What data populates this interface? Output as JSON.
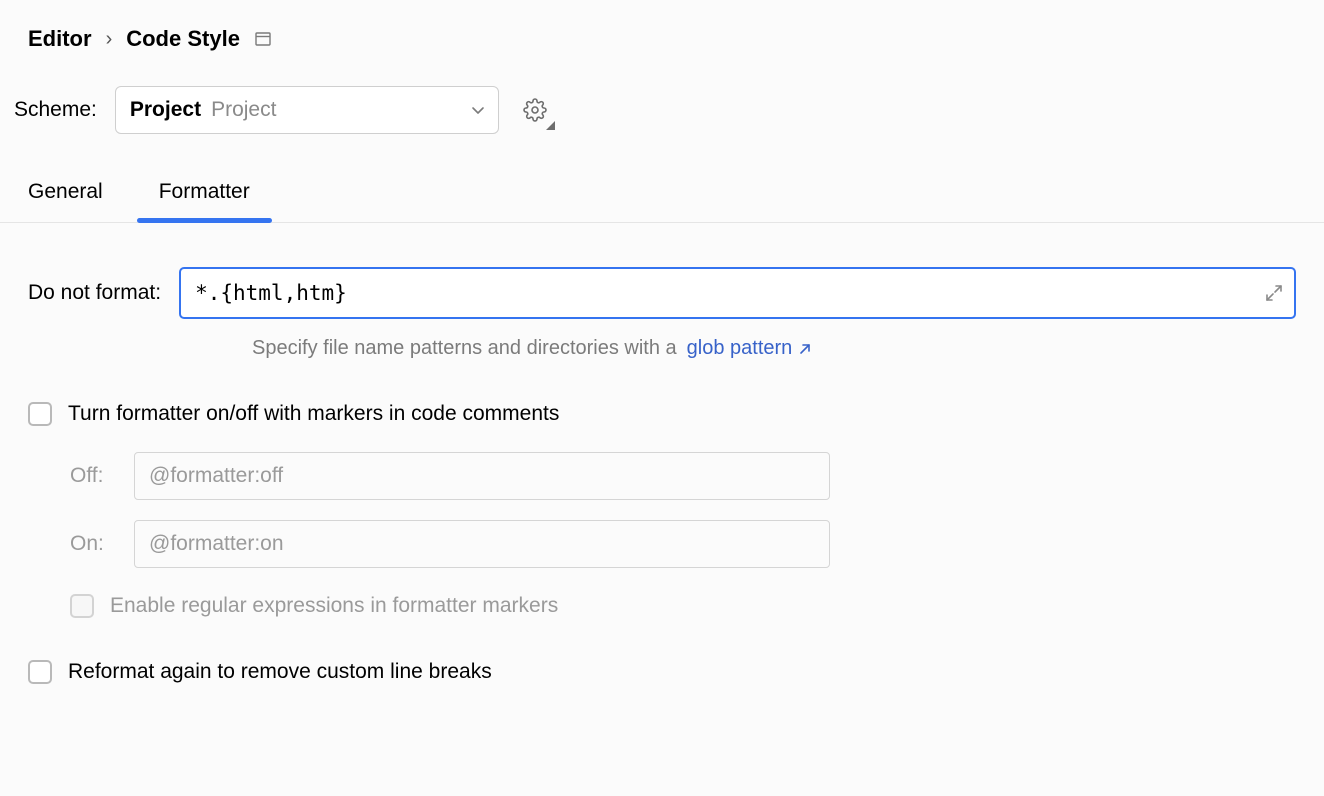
{
  "breadcrumb": {
    "parent": "Editor",
    "current": "Code Style"
  },
  "scheme": {
    "label": "Scheme:",
    "selected_bold": "Project",
    "selected_secondary": "Project"
  },
  "tabs": {
    "general": "General",
    "formatter": "Formatter"
  },
  "formatter": {
    "do_not_format_label": "Do not format:",
    "do_not_format_value": "*.{html,htm}",
    "hint_prefix": "Specify file name patterns and directories with a",
    "hint_link": "glob pattern",
    "markers_checkbox_label": "Turn formatter on/off with markers in code comments",
    "off_label": "Off:",
    "off_value": "@formatter:off",
    "on_label": "On:",
    "on_value": "@formatter:on",
    "regex_checkbox_label": "Enable regular expressions in formatter markers",
    "reformat_checkbox_label": "Reformat again to remove custom line breaks"
  }
}
